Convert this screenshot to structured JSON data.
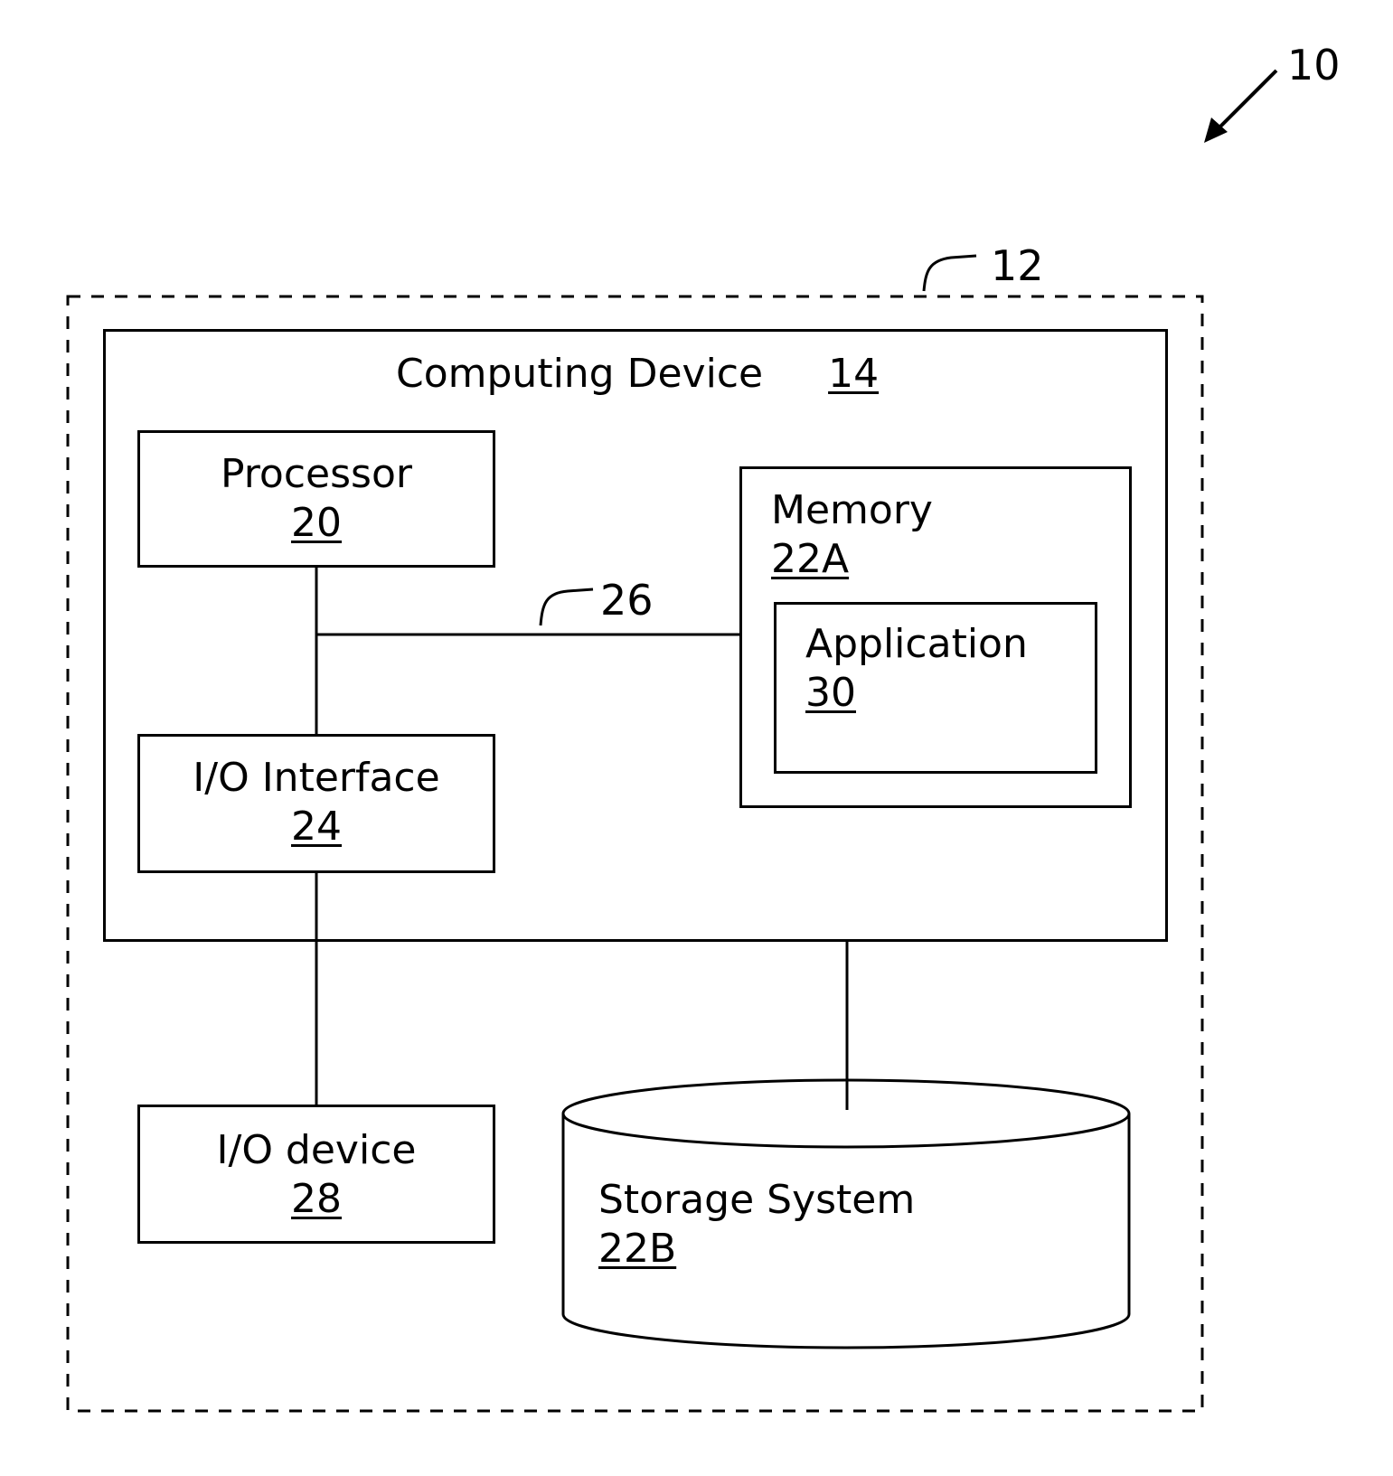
{
  "diagram": {
    "figure_ref": "10",
    "system_ref": "12",
    "bus_ref": "26",
    "computing_device": {
      "label": "Computing Device",
      "ref": "14"
    },
    "processor": {
      "label": "Processor",
      "ref": "20"
    },
    "memory": {
      "label": "Memory",
      "ref": "22A"
    },
    "application": {
      "label": "Application",
      "ref": "30"
    },
    "io_interface": {
      "label": "I/O Interface",
      "ref": "24"
    },
    "io_device": {
      "label": "I/O device",
      "ref": "28"
    },
    "storage_system": {
      "label": "Storage System",
      "ref": "22B"
    }
  }
}
